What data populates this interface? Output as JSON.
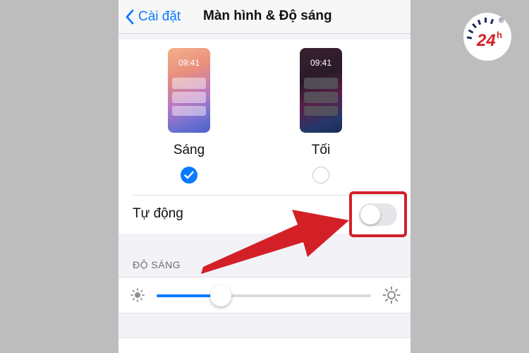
{
  "nav": {
    "back_label": "Cài đặt",
    "title": "Màn hình & Độ sáng"
  },
  "appearance": {
    "light": {
      "label": "Sáng",
      "preview_time": "09:41",
      "selected": true
    },
    "dark": {
      "label": "Tối",
      "preview_time": "09:41",
      "selected": false
    }
  },
  "auto": {
    "label": "Tự động",
    "enabled": false
  },
  "brightness": {
    "header": "ĐỘ SÁNG",
    "level": 0.3
  },
  "icons": {
    "back": "chevron-left-icon",
    "check": "checkmark-icon",
    "sun_small": "sun-small-icon",
    "sun_large": "sun-large-icon"
  },
  "logo": {
    "text": "24",
    "superscript": "h",
    "registered": "®"
  },
  "colors": {
    "accent": "#0a7aff",
    "annotation": "#d32027"
  }
}
